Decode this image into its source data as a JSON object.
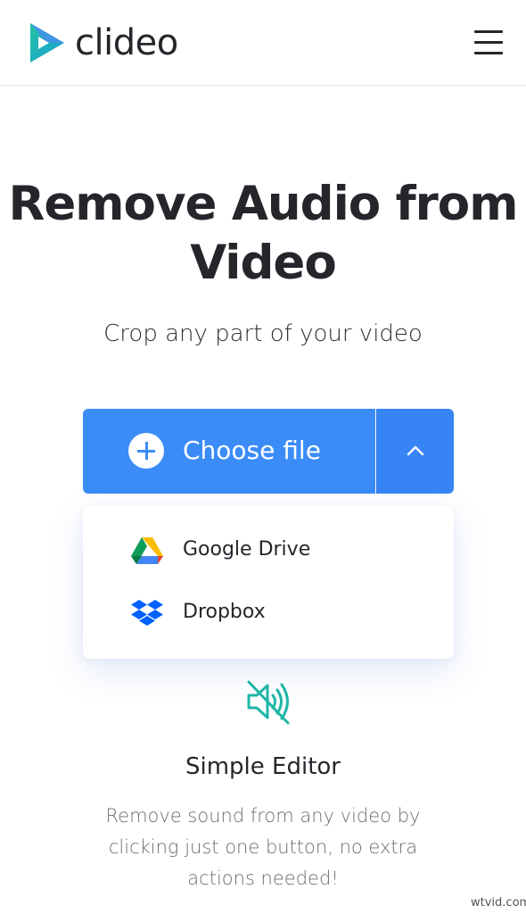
{
  "header": {
    "brand": "clideo",
    "menu_icon": "hamburger-menu-icon"
  },
  "hero": {
    "title": "Remove Audio from Video",
    "subtitle": "Crop any part of your video"
  },
  "upload": {
    "choose_label": "Choose file",
    "toggle_icon": "chevron-up-icon",
    "options": [
      {
        "label": "Google Drive",
        "icon": "google-drive-icon"
      },
      {
        "label": "Dropbox",
        "icon": "dropbox-icon"
      }
    ]
  },
  "feature": {
    "icon": "muted-speaker-icon",
    "title": "Simple Editor",
    "description": "Remove sound from any video by clicking just one button, no extra actions needed!"
  },
  "watermark": "wtvid.com",
  "colors": {
    "accent": "#3b8cf7",
    "teal": "#1fb5a8",
    "text": "#24262b"
  }
}
